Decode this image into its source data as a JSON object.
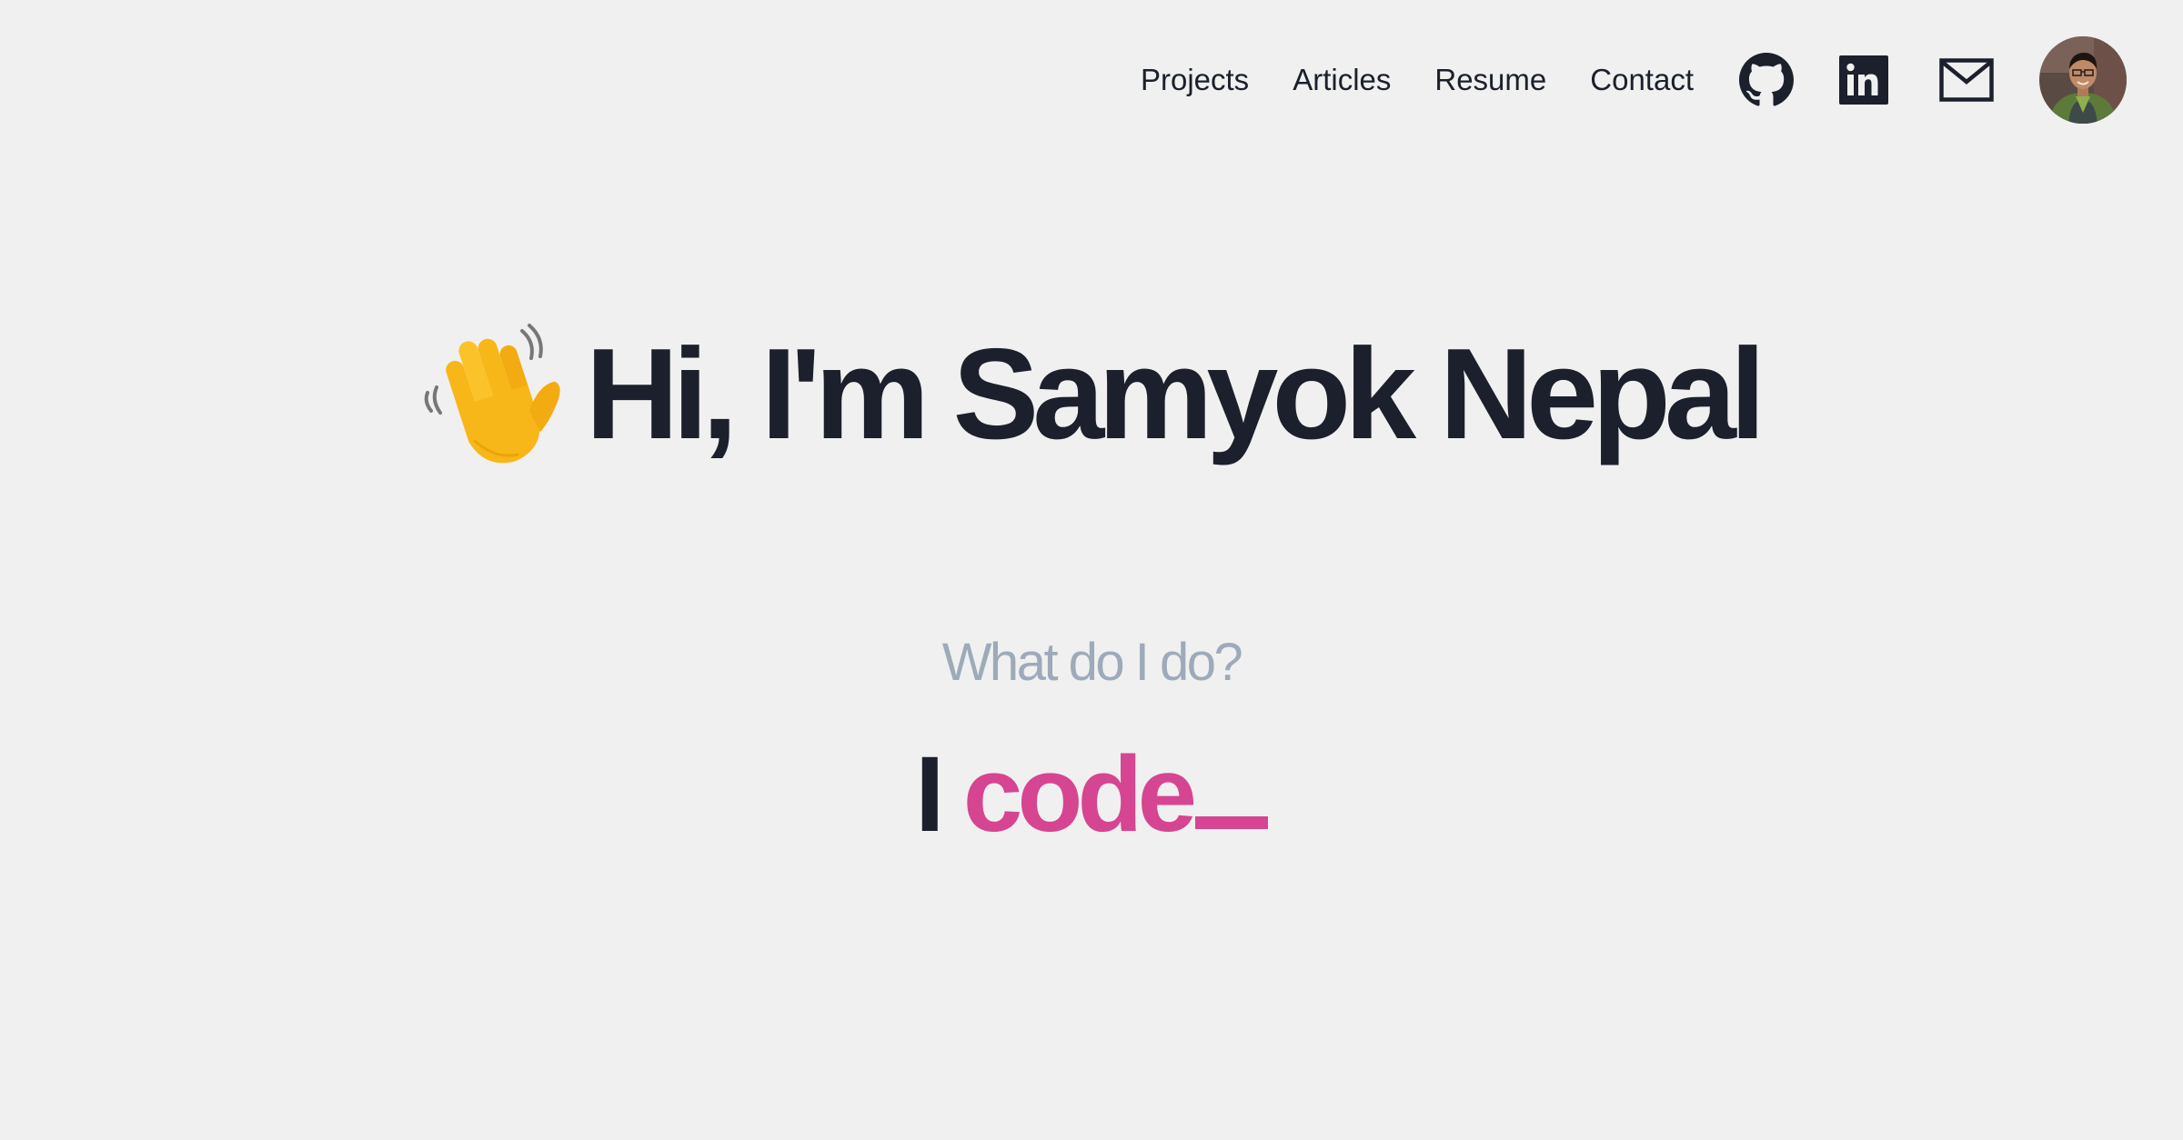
{
  "nav": {
    "links": [
      {
        "label": "Projects"
      },
      {
        "label": "Articles"
      },
      {
        "label": "Resume"
      },
      {
        "label": "Contact"
      }
    ],
    "icons": [
      "github-icon",
      "linkedin-icon",
      "mail-icon",
      "avatar"
    ]
  },
  "hero": {
    "emoji": "waving-hand-emoji",
    "headline": "Hi, I'm Samyok Nepal"
  },
  "tagline": {
    "question": "What do I do?",
    "prefix": "I",
    "word": "code"
  },
  "colors": {
    "background": "#f0f0f0",
    "text": "#1b202c",
    "muted": "#9daab9",
    "accent": "#d64591"
  }
}
